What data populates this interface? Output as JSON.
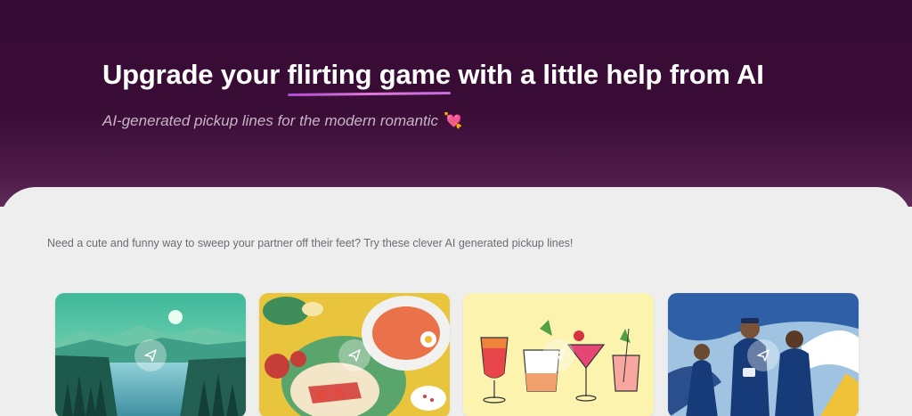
{
  "hero": {
    "title_before": "Upgrade your ",
    "title_highlight": "flirting game",
    "title_after": " with a little help from AI",
    "subtitle": "AI-generated pickup lines for the modern romantic",
    "subtitle_emoji": "💘"
  },
  "intro": "Need a cute and funny way to sweep your partner off their feet? Try these clever AI generated pickup lines!",
  "cards": [
    {
      "topic": "nature-landscape",
      "icon": "send-icon"
    },
    {
      "topic": "food",
      "icon": "send-icon"
    },
    {
      "topic": "cocktails",
      "icon": "send-icon"
    },
    {
      "topic": "cricket",
      "icon": "send-icon"
    }
  ],
  "colors": {
    "hero_bg": "#3a0d37",
    "underline": "#c66be0",
    "content_bg": "#eeeeee"
  }
}
